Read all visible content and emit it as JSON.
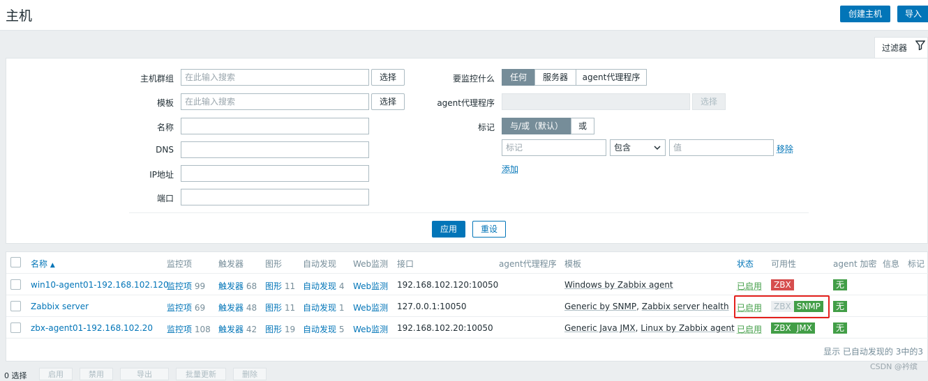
{
  "header": {
    "title": "主机",
    "create_host": "创建主机",
    "import": "导入"
  },
  "filter": {
    "tab_label": "过滤器",
    "host_groups_label": "主机群组",
    "host_groups_placeholder": "在此输入搜索",
    "templates_label": "模板",
    "templates_placeholder": "在此输入搜索",
    "select_label": "选择",
    "name_label": "名称",
    "dns_label": "DNS",
    "ip_label": "IP地址",
    "port_label": "端口",
    "monitored_by_label": "要监控什么",
    "monitored_by_options": [
      "任何",
      "服务器",
      "agent代理程序"
    ],
    "proxy_label": "agent代理程序",
    "proxy_select": "选择",
    "tags_label": "标记",
    "tags_mode_options": [
      "与/或（默认）",
      "或"
    ],
    "tag_placeholder": "标记",
    "tag_operator": "包含",
    "tag_value_placeholder": "值",
    "remove_label": "移除",
    "add_label": "添加",
    "apply_label": "应用",
    "reset_label": "重设"
  },
  "table": {
    "headers": {
      "name": "名称",
      "sort_arrow": "▲",
      "items": "监控项",
      "triggers": "触发器",
      "graphs": "图形",
      "discovery": "自动发现",
      "web": "Web监测",
      "interface": "接口",
      "proxy": "agent代理程序",
      "templates": "模板",
      "status": "状态",
      "availability": "可用性",
      "encryption": "agent 加密",
      "info": "信息",
      "tags": "标记"
    },
    "rows": [
      {
        "name": "win10-agent01-192.168.102.120",
        "items_label": "监控项",
        "items_count": "99",
        "triggers_label": "触发器",
        "triggers_count": "68",
        "graphs_label": "图形",
        "graphs_count": "11",
        "discovery_label": "自动发现",
        "discovery_count": "4",
        "web_label": "Web监测",
        "interface": "192.168.102.120:10050",
        "template1": "Windows by Zabbix agent",
        "template_sep": "",
        "template2": "",
        "status": "已启用",
        "encryption": "无"
      },
      {
        "name": "Zabbix server",
        "items_label": "监控项",
        "items_count": "69",
        "triggers_label": "触发器",
        "triggers_count": "48",
        "graphs_label": "图形",
        "graphs_count": "11",
        "discovery_label": "自动发现",
        "discovery_count": "1",
        "web_label": "Web监测",
        "interface": "127.0.0.1:10050",
        "template1": "Generic by SNMP",
        "template_sep": ", ",
        "template2": "Zabbix server health",
        "status": "已启用",
        "encryption": "无"
      },
      {
        "name": "zbx-agent01-192.168.102.20",
        "items_label": "监控项",
        "items_count": "108",
        "triggers_label": "触发器",
        "triggers_count": "42",
        "graphs_label": "图形",
        "graphs_count": "19",
        "discovery_label": "自动发现",
        "discovery_count": "5",
        "web_label": "Web监测",
        "interface": "192.168.102.20:10050",
        "template1": "Generic Java JMX",
        "template_sep": ", ",
        "template2": "Linux by Zabbix agent",
        "status": "已启用",
        "encryption": "无"
      }
    ],
    "availability": {
      "row0": [
        {
          "label": "ZBX",
          "color": "#d64e4e"
        }
      ],
      "row1": [
        {
          "label": "ZBX",
          "color": "#ebeef0"
        },
        {
          "label": "SNMP",
          "color": "#429e47"
        }
      ],
      "row2": [
        {
          "label": "ZBX",
          "color": "#429e47"
        },
        {
          "label": "JMX",
          "color": "#429e47"
        }
      ]
    },
    "footer_note": "显示 已自动发现的 3中的3"
  },
  "bottom": {
    "selected": "0 选择",
    "buttons": [
      "启用",
      "禁用",
      "导出",
      "批量更新",
      "删除"
    ]
  },
  "watermark": "CSDN @衿缤",
  "colors": {
    "primary": "#0275b8",
    "enabled_green": "#429e47",
    "error_red": "#d64e4e",
    "highlight_red": "#e4201b"
  }
}
